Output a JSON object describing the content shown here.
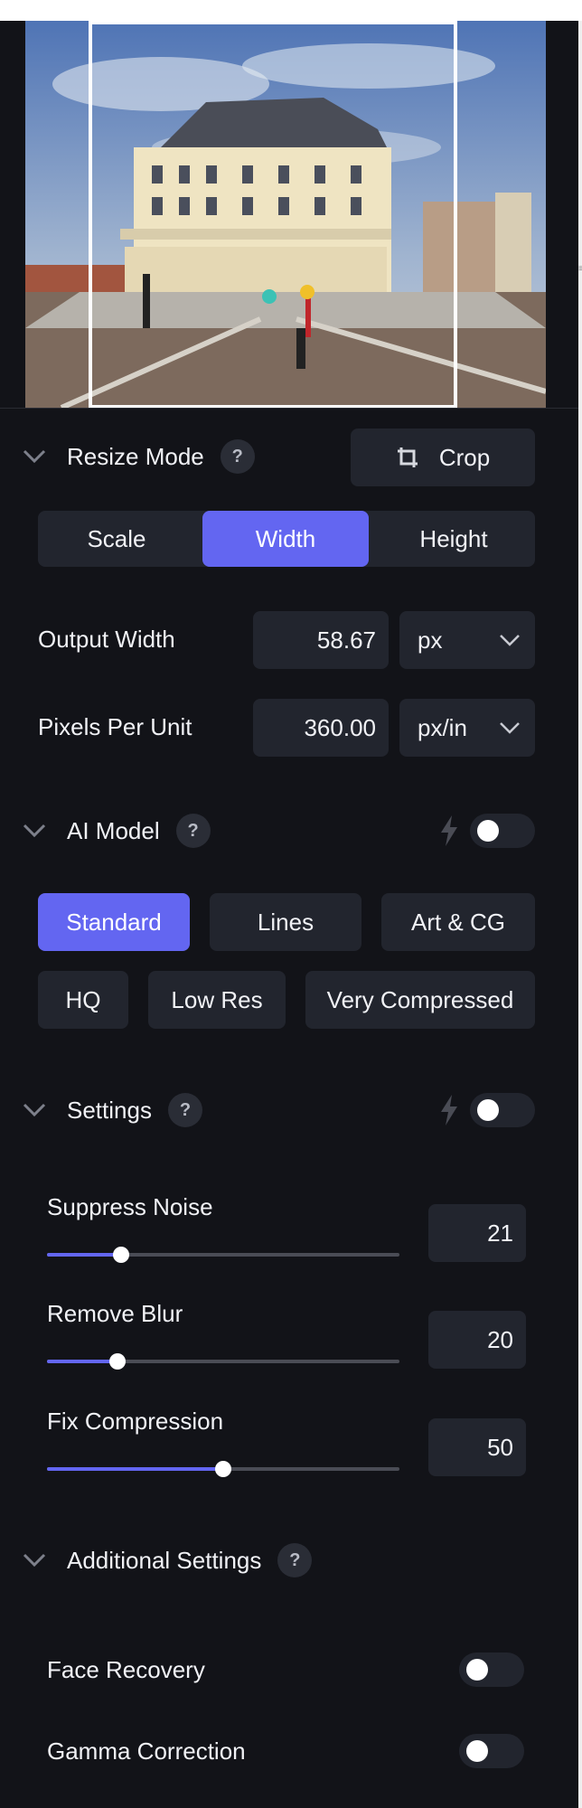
{
  "resize_mode": {
    "title": "Resize Mode",
    "help": "?",
    "crop_label": "Crop",
    "modes": [
      "Scale",
      "Width",
      "Height"
    ],
    "active_mode": "Width"
  },
  "output": {
    "width_label": "Output Width",
    "width_value": "58.67",
    "width_unit": "px",
    "ppu_label": "Pixels Per Unit",
    "ppu_value": "360.00",
    "ppu_unit": "px/in"
  },
  "ai_model": {
    "title": "AI Model",
    "help": "?",
    "toggle_on": false,
    "models": [
      "Standard",
      "Lines",
      "Art & CG",
      "HQ",
      "Low Res",
      "Very Compressed"
    ],
    "active_model": "Standard"
  },
  "settings": {
    "title": "Settings",
    "help": "?",
    "toggle_on": false,
    "sliders": [
      {
        "label": "Suppress Noise",
        "value": "21",
        "level": 21
      },
      {
        "label": "Remove Blur",
        "value": "20",
        "level": 20
      },
      {
        "label": "Fix Compression",
        "value": "50",
        "level": 50
      }
    ]
  },
  "additional": {
    "title": "Additional Settings",
    "help": "?",
    "rows": [
      {
        "label": "Face Recovery",
        "on": false
      },
      {
        "label": "Gamma Correction",
        "on": false
      }
    ]
  },
  "colors": {
    "accent": "#6366f1",
    "background": "#121318",
    "control": "#22252e"
  },
  "icons": {
    "chevron": "chevron-down-icon",
    "crop": "crop-icon",
    "dropdown": "chevron-down-icon",
    "bolt": "lightning-bolt-icon"
  }
}
